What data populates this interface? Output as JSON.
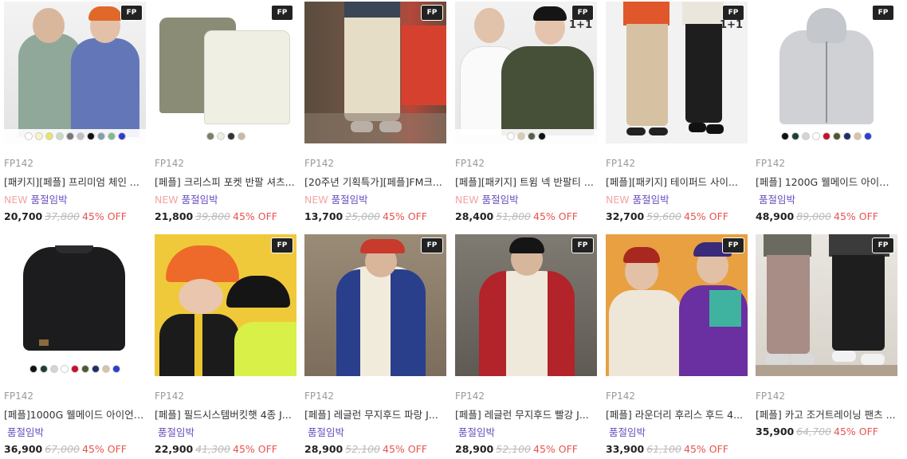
{
  "products": [
    {
      "brand": "FP142",
      "name": "[패키지][페플] 프리미엄 체인 ...",
      "tag_new": "NEW",
      "tag_status": "품절임박",
      "price": "20,700",
      "original_price": "37,800",
      "discount": "45% OFF",
      "logo": "FP",
      "badge": "",
      "swatches": [
        "#ffffff",
        "#f6f4c8",
        "#e9e36a",
        "#c9dcc2",
        "#777777",
        "#bfbfbf",
        "#111111",
        "#7f9fb0",
        "#7fb98f",
        "#2b3ecf"
      ],
      "image": "models-tshirts"
    },
    {
      "brand": "FP142",
      "name": "[페플] 크리스피 포켓 반팔 셔츠...",
      "tag_new": "NEW",
      "tag_status": "품절임박",
      "price": "21,800",
      "original_price": "39,800",
      "discount": "45% OFF",
      "logo": "FP",
      "badge": "",
      "swatches": [
        "#7d8069",
        "#efeee2",
        "#333333",
        "#c9b9a0"
      ],
      "image": "pocket-shirts"
    },
    {
      "brand": "FP142",
      "name": "[20주년 기획특가][페플]FM크...",
      "tag_new": "NEW",
      "tag_status": "품절임박",
      "price": "13,700",
      "original_price": "25,000",
      "discount": "45% OFF",
      "logo": "FP",
      "badge": "",
      "swatches": [],
      "image": "cream-pants"
    },
    {
      "brand": "FP142",
      "name": "[페플][패키지] 트윔 넥 반팔티 ...",
      "tag_new": "NEW",
      "tag_status": "품절임박",
      "price": "28,400",
      "original_price": "51,800",
      "discount": "45% OFF",
      "logo": "FP",
      "badge": "1+1",
      "swatches": [
        "#ffffff",
        "#d8cbb0",
        "#556045",
        "#111111"
      ],
      "image": "henley-tees"
    },
    {
      "brand": "FP142",
      "name": "[페플][패키지] 테이퍼드 사이...",
      "tag_new": "NEW",
      "tag_status": "품절임박",
      "price": "32,700",
      "original_price": "59,600",
      "discount": "45% OFF",
      "logo": "FP",
      "badge": "1+1",
      "swatches": [],
      "image": "tapered-pants"
    },
    {
      "brand": "FP142",
      "name": "[페플] 1200G 웰메이드 아이언...",
      "tag_new": "",
      "tag_status": "품절임박",
      "price": "48,900",
      "original_price": "89,000",
      "discount": "45% OFF",
      "logo": "FP",
      "badge": "",
      "swatches": [
        "#111111",
        "#1f3f34",
        "#d4d4d4",
        "#ffffff",
        "#c8102e",
        "#4e5a2c",
        "#1f2f66",
        "#d7c4a2",
        "#2b3ecf"
      ],
      "image": "grey-zip-hoodie"
    },
    {
      "brand": "FP142",
      "name": "[페플]1000G 웰메이드 아이언 ...",
      "tag_new": "",
      "tag_status": "품절임박",
      "price": "36,900",
      "original_price": "67,000",
      "discount": "45% OFF",
      "logo": "",
      "badge": "",
      "swatches": [
        "#111111",
        "#1f3f34",
        "#d4d4d4",
        "#ffffff",
        "#c8102e",
        "#4e5a2c",
        "#1f2f66",
        "#d7c4a2",
        "#2b3ecf"
      ],
      "image": "black-sweatshirt"
    },
    {
      "brand": "FP142",
      "name": "[페플] 필드시스템버킷햇 4종 J...",
      "tag_new": "",
      "tag_status": "품절임박",
      "price": "22,900",
      "original_price": "41,300",
      "discount": "45% OFF",
      "logo": "FP",
      "badge": "",
      "swatches": [],
      "image": "bucket-hats"
    },
    {
      "brand": "FP142",
      "name": "[페플] 레글런 무지후드 파랑 J...",
      "tag_new": "",
      "tag_status": "품절임박",
      "price": "28,900",
      "original_price": "52,100",
      "discount": "45% OFF",
      "logo": "FP",
      "badge": "",
      "swatches": [],
      "image": "blue-raglan-hoodie"
    },
    {
      "brand": "FP142",
      "name": "[페플] 레글런 무지후드 빨강 J...",
      "tag_new": "",
      "tag_status": "품절임박",
      "price": "28,900",
      "original_price": "52,100",
      "discount": "45% OFF",
      "logo": "FP",
      "badge": "",
      "swatches": [],
      "image": "red-raglan-hoodie"
    },
    {
      "brand": "FP142",
      "name": "[페플] 라운더리 후리스 후드 4...",
      "tag_new": "",
      "tag_status": "품절임박",
      "price": "33,900",
      "original_price": "61,100",
      "discount": "45% OFF",
      "logo": "FP",
      "badge": "",
      "swatches": [],
      "image": "fleece-hoodies"
    },
    {
      "brand": "FP142",
      "name": "[페플] 카고 조거트레이닝 팬츠 ...",
      "tag_new": "",
      "tag_status": "",
      "price": "35,900",
      "original_price": "64,700",
      "discount": "45% OFF",
      "logo": "FP",
      "badge": "",
      "swatches": [],
      "image": "cargo-joggers"
    }
  ]
}
